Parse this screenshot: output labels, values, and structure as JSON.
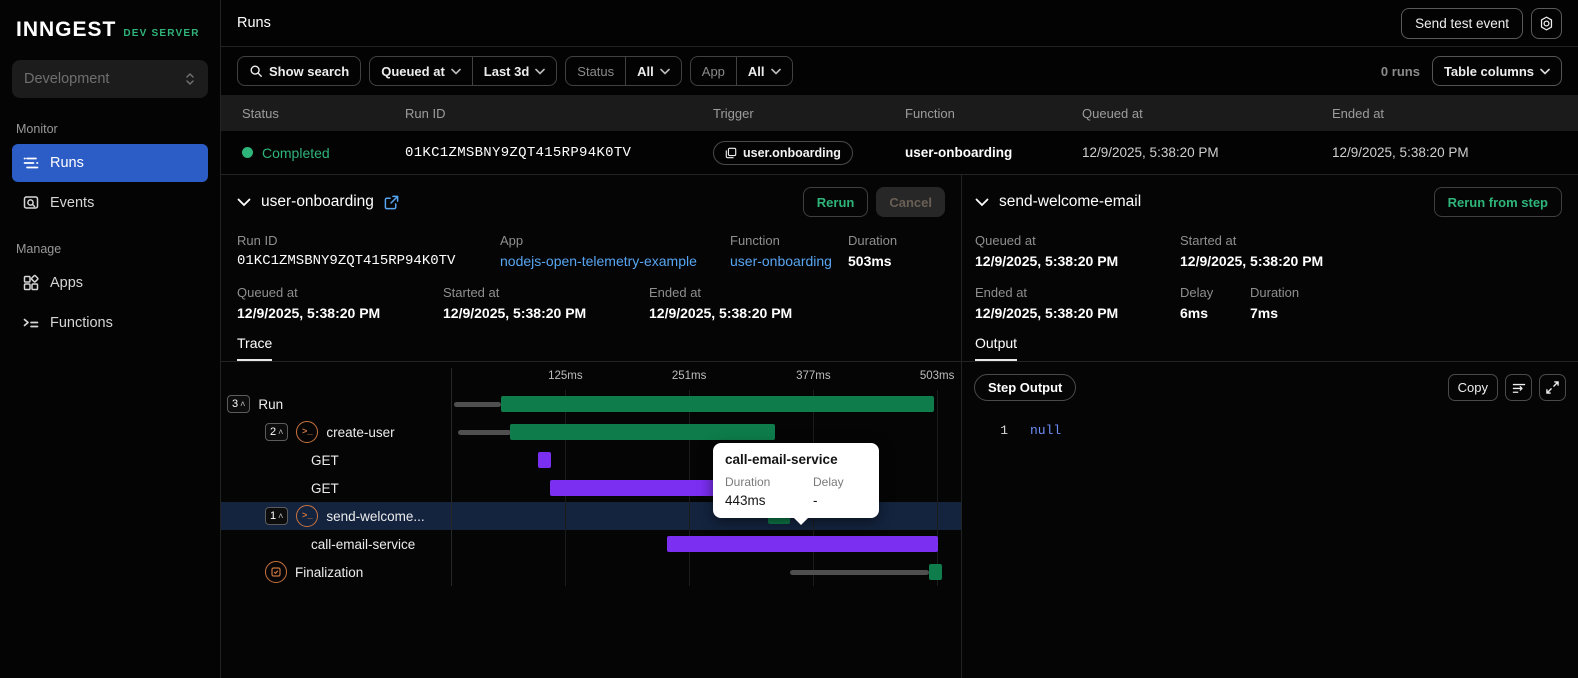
{
  "colors": {
    "accent_green": "#2fb47a",
    "bar_green": "#0e7c4b",
    "bar_purple": "#7b2ff1",
    "active_nav_blue": "#2c5cc5",
    "link_blue": "#58a5f2",
    "code_blue": "#6d8ef7",
    "tooltip_bg": "#ffffff"
  },
  "sidebar": {
    "logo": "INNGEST",
    "logo_badge": "DEV SERVER",
    "env": "Development",
    "sections": [
      {
        "label": "Monitor",
        "items": [
          {
            "label": "Runs",
            "icon": "runs",
            "active": true
          },
          {
            "label": "Events",
            "icon": "events",
            "active": false
          }
        ]
      },
      {
        "label": "Manage",
        "items": [
          {
            "label": "Apps",
            "icon": "apps",
            "active": false
          },
          {
            "label": "Functions",
            "icon": "functions",
            "active": false
          }
        ]
      }
    ]
  },
  "topbar": {
    "title": "Runs",
    "send_test_event": "Send test event"
  },
  "filterbar": {
    "show_search": "Show search",
    "queued_at": "Queued at",
    "range": "Last 3d",
    "status_label": "Status",
    "status_value": "All",
    "app_label": "App",
    "app_value": "All",
    "runs_count": "0 runs",
    "table_columns": "Table columns"
  },
  "table": {
    "columns": [
      "Status",
      "Run ID",
      "Trigger",
      "Function",
      "Queued at",
      "Ended at"
    ],
    "row": {
      "status": "Completed",
      "run_id": "01KC1ZMSBNY9ZQT415RP94K0TV",
      "trigger": "user.onboarding",
      "function": "user-onboarding",
      "queued_at": "12/9/2025, 5:38:20 PM",
      "ended_at": "12/9/2025, 5:38:20 PM"
    }
  },
  "run_panel": {
    "title": "user-onboarding",
    "rerun_label": "Rerun",
    "cancel_label": "Cancel",
    "fields_row1": [
      {
        "label": "Run ID",
        "value": "01KC1ZMSBNY9ZQT415RP94K0TV",
        "kind": "mono"
      },
      {
        "label": "App",
        "value": "nodejs-open-telemetry-example",
        "kind": "link"
      },
      {
        "label": "Function",
        "value": "user-onboarding",
        "kind": "link"
      },
      {
        "label": "Duration",
        "value": "503ms",
        "kind": "bold"
      }
    ],
    "fields_row2": [
      {
        "label": "Queued at",
        "value": "12/9/2025, 5:38:20 PM",
        "kind": "bold"
      },
      {
        "label": "Started at",
        "value": "12/9/2025, 5:38:20 PM",
        "kind": "bold"
      },
      {
        "label": "Ended at",
        "value": "12/9/2025, 5:38:20 PM",
        "kind": "bold"
      }
    ],
    "tab": "Trace"
  },
  "trace": {
    "axis": [
      {
        "label": "125ms",
        "pos": 23.0
      },
      {
        "label": "251ms",
        "pos": 48.1
      },
      {
        "label": "377ms",
        "pos": 73.3
      },
      {
        "label": "503ms",
        "pos": 98.4
      }
    ],
    "rows": [
      {
        "indent": 0,
        "badge": "3",
        "icon": null,
        "name": "Run",
        "highlighted": false,
        "bars": [
          {
            "type": "queue",
            "start": 0.5,
            "end": 10.0
          },
          {
            "type": "green",
            "start": 10.0,
            "end": 97.8
          }
        ]
      },
      {
        "indent": 1,
        "badge": "2",
        "icon": "step",
        "name": "create-user",
        "highlighted": false,
        "bars": [
          {
            "type": "queue",
            "start": 1.2,
            "end": 12.0
          },
          {
            "type": "green",
            "start": 11.7,
            "end": 65.6
          }
        ]
      },
      {
        "indent": 2,
        "badge": null,
        "icon": null,
        "name": "GET",
        "highlighted": false,
        "bars": [
          {
            "type": "purple",
            "start": 17.4,
            "end": 20.1
          }
        ]
      },
      {
        "indent": 2,
        "badge": null,
        "icon": null,
        "name": "GET",
        "highlighted": false,
        "bars": [
          {
            "type": "purple",
            "start": 19.8,
            "end": 59.6
          }
        ]
      },
      {
        "indent": 1,
        "badge": "1",
        "icon": "step",
        "name": "send-welcome...",
        "highlighted": true,
        "bars": [
          {
            "type": "green",
            "start": 64.0,
            "end": 68.5
          }
        ]
      },
      {
        "indent": 2,
        "badge": null,
        "icon": null,
        "name": "call-email-service",
        "highlighted": false,
        "bars": [
          {
            "type": "purple",
            "start": 43.6,
            "end": 98.5
          }
        ]
      },
      {
        "indent": 1,
        "badge": null,
        "icon": "finalization",
        "name": "Finalization",
        "highlighted": false,
        "bars": [
          {
            "type": "queue",
            "start": 68.5,
            "end": 96.8
          },
          {
            "type": "green",
            "start": 96.8,
            "end": 99.3
          }
        ]
      }
    ],
    "tooltip": {
      "title": "call-email-service",
      "duration_label": "Duration",
      "duration": "443ms",
      "delay_label": "Delay",
      "delay": "-"
    }
  },
  "step_panel": {
    "title": "send-welcome-email",
    "rerun_label": "Rerun from step",
    "fields_row1": [
      {
        "label": "Queued at",
        "value": "12/9/2025, 5:38:20 PM",
        "kind": "bold"
      },
      {
        "label": "Started at",
        "value": "12/9/2025, 5:38:20 PM",
        "kind": "bold"
      }
    ],
    "fields_row2": [
      {
        "label": "Ended at",
        "value": "12/9/2025, 5:38:20 PM",
        "kind": "bold"
      },
      {
        "label": "Delay",
        "value": "6ms",
        "kind": "bold"
      },
      {
        "label": "Duration",
        "value": "7ms",
        "kind": "bold"
      }
    ],
    "tab": "Output",
    "output_badge": "Step Output",
    "copy_label": "Copy",
    "code": {
      "line": "1",
      "value": "null"
    }
  }
}
